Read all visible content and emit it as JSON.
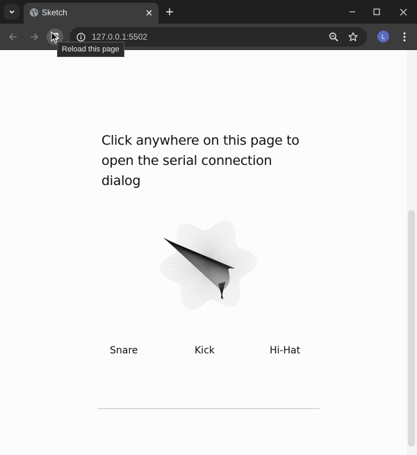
{
  "tab": {
    "title": "Sketch"
  },
  "toolbar": {
    "url": "127.0.0.1:5502",
    "avatar_initial": "L",
    "reload_tooltip": "Reload this page"
  },
  "page": {
    "instruction_line1": "Click anywhere on this page to",
    "instruction_line2": "open the serial connection dialog",
    "pads": [
      {
        "label": "Snare"
      },
      {
        "label": "Kick"
      },
      {
        "label": "Hi-Hat"
      }
    ]
  },
  "colors": {
    "titlebar": "#1f1f1f",
    "toolbar": "#3c3c3c",
    "page_background": "#fdfcfd",
    "avatar": "#5c6bc0"
  },
  "icons": {
    "tab_search": "chevron-down-icon",
    "favicon": "globe-icon",
    "tab_close": "close-icon",
    "new_tab": "plus-icon",
    "minimize": "minimize-icon",
    "maximize": "maximize-icon",
    "close_window": "close-icon",
    "back": "arrow-left-icon",
    "forward": "arrow-right-icon",
    "reload": "reload-icon",
    "site_info": "info-icon",
    "zoom": "zoom-icon",
    "bookmark": "star-icon",
    "menu": "more-vert-icon"
  }
}
